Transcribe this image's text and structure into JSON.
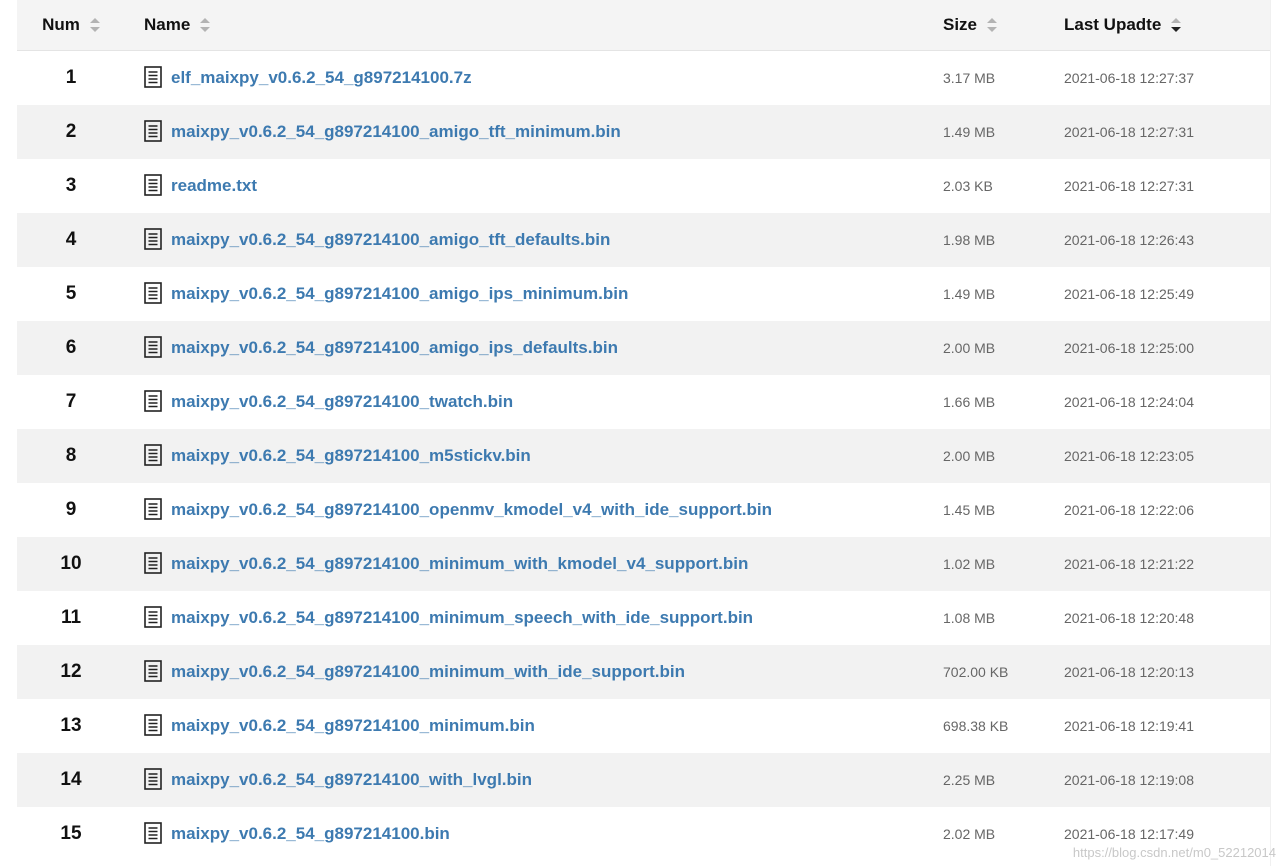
{
  "header": {
    "num": "Num",
    "name": "Name",
    "size": "Size",
    "date": "Last Upadte"
  },
  "files": [
    {
      "num": "1",
      "name": "elf_maixpy_v0.6.2_54_g897214100.7z",
      "size": "3.17 MB",
      "date": "2021-06-18 12:27:37"
    },
    {
      "num": "2",
      "name": "maixpy_v0.6.2_54_g897214100_amigo_tft_minimum.bin",
      "size": "1.49 MB",
      "date": "2021-06-18 12:27:31"
    },
    {
      "num": "3",
      "name": "readme.txt",
      "size": "2.03 KB",
      "date": "2021-06-18 12:27:31"
    },
    {
      "num": "4",
      "name": "maixpy_v0.6.2_54_g897214100_amigo_tft_defaults.bin",
      "size": "1.98 MB",
      "date": "2021-06-18 12:26:43"
    },
    {
      "num": "5",
      "name": "maixpy_v0.6.2_54_g897214100_amigo_ips_minimum.bin",
      "size": "1.49 MB",
      "date": "2021-06-18 12:25:49"
    },
    {
      "num": "6",
      "name": "maixpy_v0.6.2_54_g897214100_amigo_ips_defaults.bin",
      "size": "2.00 MB",
      "date": "2021-06-18 12:25:00"
    },
    {
      "num": "7",
      "name": "maixpy_v0.6.2_54_g897214100_twatch.bin",
      "size": "1.66 MB",
      "date": "2021-06-18 12:24:04"
    },
    {
      "num": "8",
      "name": "maixpy_v0.6.2_54_g897214100_m5stickv.bin",
      "size": "2.00 MB",
      "date": "2021-06-18 12:23:05"
    },
    {
      "num": "9",
      "name": "maixpy_v0.6.2_54_g897214100_openmv_kmodel_v4_with_ide_support.bin",
      "size": "1.45 MB",
      "date": "2021-06-18 12:22:06"
    },
    {
      "num": "10",
      "name": "maixpy_v0.6.2_54_g897214100_minimum_with_kmodel_v4_support.bin",
      "size": "1.02 MB",
      "date": "2021-06-18 12:21:22"
    },
    {
      "num": "11",
      "name": "maixpy_v0.6.2_54_g897214100_minimum_speech_with_ide_support.bin",
      "size": "1.08 MB",
      "date": "2021-06-18 12:20:48"
    },
    {
      "num": "12",
      "name": "maixpy_v0.6.2_54_g897214100_minimum_with_ide_support.bin",
      "size": "702.00 KB",
      "date": "2021-06-18 12:20:13"
    },
    {
      "num": "13",
      "name": "maixpy_v0.6.2_54_g897214100_minimum.bin",
      "size": "698.38 KB",
      "date": "2021-06-18 12:19:41"
    },
    {
      "num": "14",
      "name": "maixpy_v0.6.2_54_g897214100_with_lvgl.bin",
      "size": "2.25 MB",
      "date": "2021-06-18 12:19:08"
    },
    {
      "num": "15",
      "name": "maixpy_v0.6.2_54_g897214100.bin",
      "size": "2.02 MB",
      "date": "2021-06-18 12:17:49"
    }
  ],
  "file_icon": "document-icon",
  "watermark": "https://blog.csdn.net/m0_52212014",
  "colors": {
    "link": "#3d7ab0",
    "row_shade": "#f2f2f2",
    "header_bg": "#f4f4f4"
  }
}
